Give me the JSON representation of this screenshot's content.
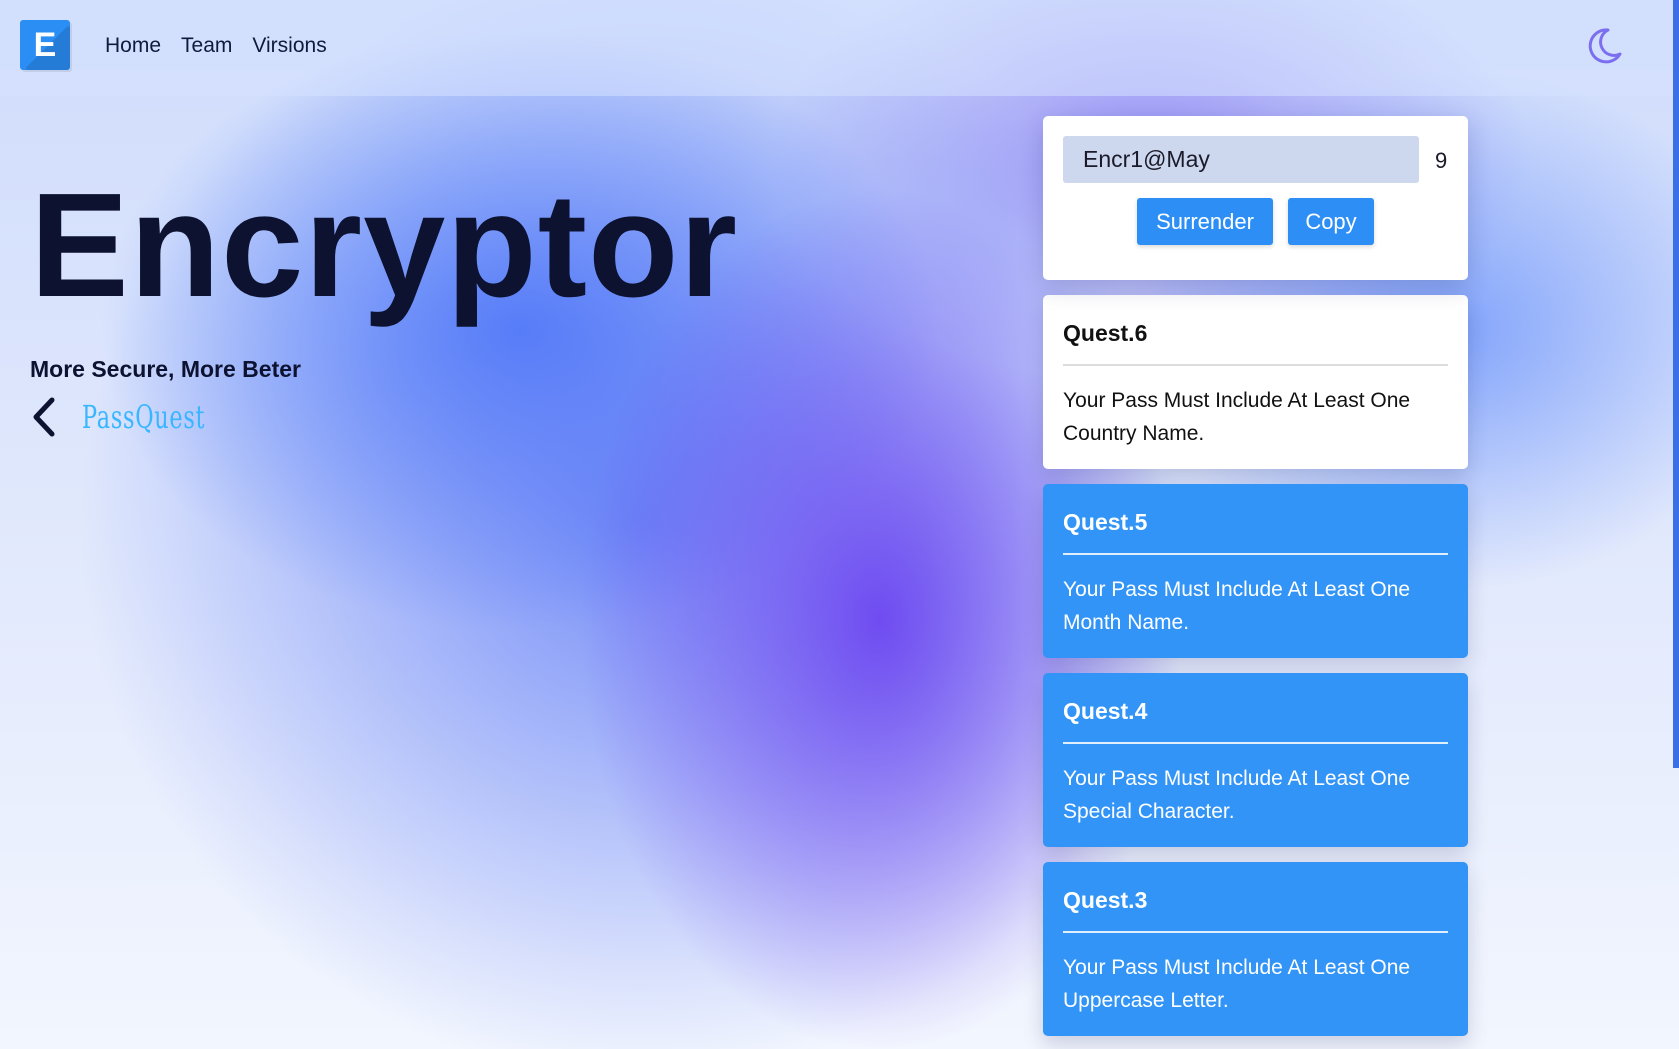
{
  "nav": {
    "logo_letter": "E",
    "links": [
      {
        "label": "Home"
      },
      {
        "label": "Team"
      },
      {
        "label": "Virsions"
      }
    ],
    "theme_toggle_icon": "moon-icon"
  },
  "hero": {
    "title": "Encryptor",
    "subtitle": "More Secure, More Beter",
    "back_icon": "chevron-left-icon",
    "link_label": "PassQuest"
  },
  "password_panel": {
    "value": "Encr1@May",
    "length": "9",
    "surrender_label": "Surrender",
    "copy_label": "Copy"
  },
  "quests": [
    {
      "title": "Quest.6",
      "text": "Your Pass Must Include At Least One Country Name.",
      "status": "active"
    },
    {
      "title": "Quest.5",
      "text": "Your Pass Must Include At Least One Month Name.",
      "status": "done"
    },
    {
      "title": "Quest.4",
      "text": "Your Pass Must Include At Least One Special Character.",
      "status": "done"
    },
    {
      "title": "Quest.3",
      "text": "Your Pass Must Include At Least One Uppercase Letter.",
      "status": "done"
    }
  ],
  "colors": {
    "accent": "#2d8ff5",
    "done_card": "#3194f6",
    "title_text": "#0c1230",
    "link": "#38b6ff",
    "moon": "#7b6ff0"
  }
}
